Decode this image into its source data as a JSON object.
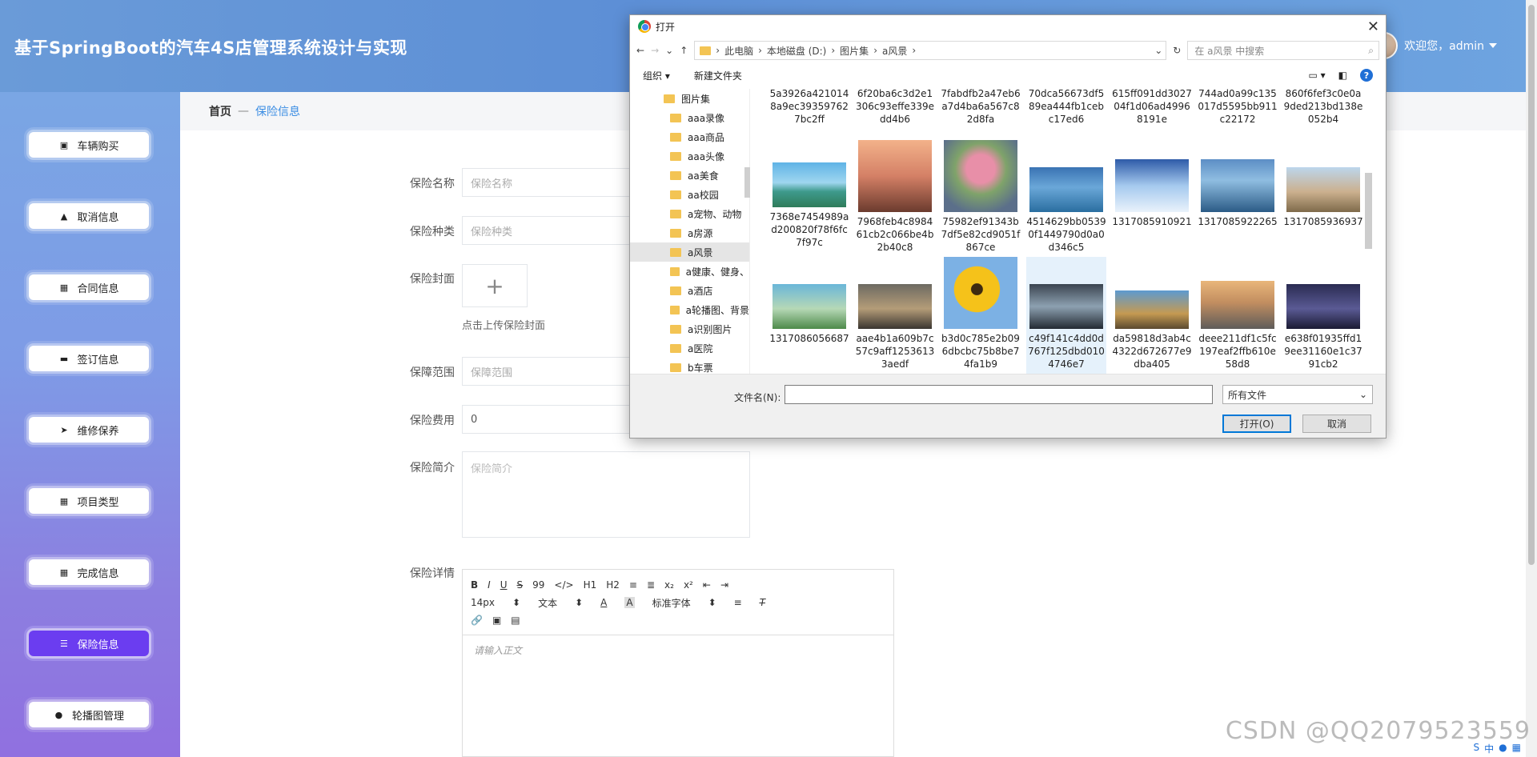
{
  "header": {
    "title": "基于SpringBoot的汽车4S店管理系统设计与实现",
    "welcome": "欢迎您，admin"
  },
  "sidebar": {
    "items": [
      {
        "label": "车辆购买",
        "icon": "clipboard-icon"
      },
      {
        "label": "取消信息",
        "icon": "thumb-icon"
      },
      {
        "label": "合同信息",
        "icon": "grid-icon"
      },
      {
        "label": "签订信息",
        "icon": "chat-icon"
      },
      {
        "label": "维修保养",
        "icon": "send-icon"
      },
      {
        "label": "项目类型",
        "icon": "grid-icon"
      },
      {
        "label": "完成信息",
        "icon": "grid-icon"
      },
      {
        "label": "保险信息",
        "icon": "sliders-icon",
        "active": true
      },
      {
        "label": "轮播图管理",
        "icon": "pin-icon"
      }
    ]
  },
  "breadcrumb": {
    "home": "首页",
    "sep": "—",
    "current": "保险信息"
  },
  "form": {
    "name_label": "保险名称",
    "name_ph": "保险名称",
    "type_label": "保险种类",
    "type_ph": "保险种类",
    "cover_label": "保险封面",
    "cover_hint": "点击上传保险封面",
    "plus": "+",
    "scope_label": "保障范围",
    "scope_ph": "保障范围",
    "fee_label": "保险费用",
    "fee_value": "0",
    "intro_label": "保险简介",
    "intro_ph": "保险简介",
    "detail_label": "保险详情"
  },
  "editor": {
    "row1": [
      "B",
      "I",
      "U",
      "S",
      "99",
      "</>",
      "H1",
      "H2",
      "≡",
      "≣",
      "x₂",
      "x²",
      "⇤",
      "⇥"
    ],
    "font_size": "14px",
    "text_type": "文本",
    "font_family": "标准字体",
    "placeholder": "请输入正文"
  },
  "dialog": {
    "title": "打开",
    "path": [
      "此电脑",
      "本地磁盘 (D:)",
      "图片集",
      "a风景"
    ],
    "search_ph": "在 a风景 中搜索",
    "organize": "组织 ▾",
    "new_folder": "新建文件夹",
    "tree": [
      "图片集",
      "aaa录像",
      "aaa商品",
      "aaa头像",
      "aa美食",
      "aa校园",
      "a宠物、动物",
      "a房源",
      "a风景",
      "a健康、健身、",
      "a酒店",
      "a轮播图、背景",
      "a识别图片",
      "a医院",
      "b车票"
    ],
    "row0": [
      "5a3926a4210148a9ec393597627bc2ff",
      "6f20ba6c3d2e1306c93effe339edd4b6",
      "7fabdfb2a47eb6a7d4ba6a567c82d8fa",
      "70dca56673df589ea444fb1cebc17ed6",
      "615ff091dd302704f1d06ad49968191e",
      "744ad0a99c135017d5595bb911c22172",
      "860f6fef3c0e0a9ded213bd138e052b4"
    ],
    "row1": [
      "7368e7454989ad200820f78f6fc7f97c",
      "7968feb4c898461cb2c066be4b2b40c8",
      "75982ef91343b7df5e82cd9051f867ce",
      "4514629bb05390f1449790d0a0d346c5",
      "1317085910921",
      "1317085922265",
      "1317085936937"
    ],
    "row2": [
      "1317086056687",
      "aae4b1a609b7c57c9aff12536133aedf",
      "b3d0c785e2b096dbcbc75b8be74fa1b9",
      "c49f141c4dd0d767f125dbd0104746e7",
      "da59818d3ab4c4322d672677e9dba405",
      "deee211df1c5fc197eaf2ffb610e58d8",
      "e638f01935ffd19ee31160e1c3791cb2"
    ],
    "filename_label": "文件名(N):",
    "filetype": "所有文件",
    "open": "打开(O)",
    "cancel": "取消"
  },
  "watermark": "CSDN @QQ2079523559"
}
